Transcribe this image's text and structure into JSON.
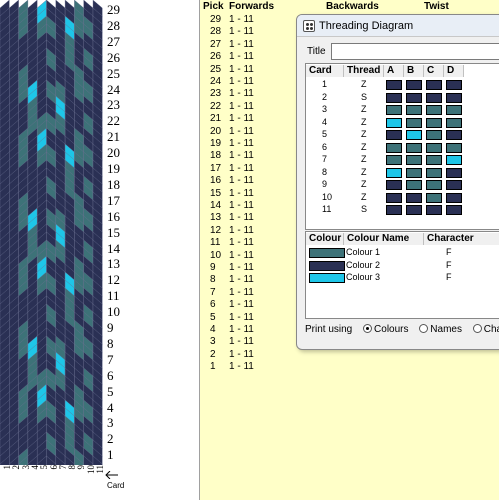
{
  "colors": {
    "colour1": "#3d7278",
    "colour2": "#2a3054",
    "colour3": "#1ec6e8",
    "chart_bg": "#ffffc8"
  },
  "weave": {
    "row_numbers": [
      "29",
      "28",
      "27",
      "26",
      "25",
      "24",
      "23",
      "22",
      "21",
      "20",
      "19",
      "18",
      "17",
      "16",
      "15",
      "14",
      "13",
      "12",
      "11",
      "10",
      "9",
      "8",
      "7",
      "6",
      "5",
      "4",
      "3",
      "2",
      "1"
    ],
    "card_numbers": [
      "1",
      "2",
      "3",
      "4",
      "5",
      "6",
      "7",
      "8",
      "9",
      "10",
      "11"
    ],
    "card_label": "Card"
  },
  "table": {
    "headers": {
      "pick": "Pick",
      "forwards": "Forwards",
      "backwards": "Backwards",
      "twist": "Twist"
    },
    "rows": [
      {
        "pick": "29",
        "forwards": "1 - 11"
      },
      {
        "pick": "28",
        "forwards": "1 - 11"
      },
      {
        "pick": "27",
        "forwards": "1 - 11"
      },
      {
        "pick": "26",
        "forwards": "1 - 11"
      },
      {
        "pick": "25",
        "forwards": "1 - 11"
      },
      {
        "pick": "24",
        "forwards": "1 - 11"
      },
      {
        "pick": "23",
        "forwards": "1 - 11"
      },
      {
        "pick": "22",
        "forwards": "1 - 11"
      },
      {
        "pick": "21",
        "forwards": "1 - 11"
      },
      {
        "pick": "20",
        "forwards": "1 - 11"
      },
      {
        "pick": "19",
        "forwards": "1 - 11"
      },
      {
        "pick": "18",
        "forwards": "1 - 11"
      },
      {
        "pick": "17",
        "forwards": "1 - 11"
      },
      {
        "pick": "16",
        "forwards": "1 - 11"
      },
      {
        "pick": "15",
        "forwards": "1 - 11"
      },
      {
        "pick": "14",
        "forwards": "1 - 11"
      },
      {
        "pick": "13",
        "forwards": "1 - 11"
      },
      {
        "pick": "12",
        "forwards": "1 - 11"
      },
      {
        "pick": "11",
        "forwards": "1 - 11"
      },
      {
        "pick": "10",
        "forwards": "1 - 11"
      },
      {
        "pick": "9",
        "forwards": "1 - 11"
      },
      {
        "pick": "8",
        "forwards": "1 - 11"
      },
      {
        "pick": "7",
        "forwards": "1 - 11"
      },
      {
        "pick": "6",
        "forwards": "1 - 11"
      },
      {
        "pick": "5",
        "forwards": "1 - 11"
      },
      {
        "pick": "4",
        "forwards": "1 - 11"
      },
      {
        "pick": "3",
        "forwards": "1 - 11"
      },
      {
        "pick": "2",
        "forwards": "1 - 11"
      },
      {
        "pick": "1",
        "forwards": "1 - 11"
      }
    ]
  },
  "dialog": {
    "title": "Threading Diagram",
    "title_label": "Title",
    "title_value": "",
    "threading": {
      "headers": [
        "Card",
        "Thread",
        "A",
        "B",
        "C",
        "D"
      ],
      "rows": [
        {
          "card": "1",
          "thread": "Z",
          "holes": [
            2,
            2,
            2,
            2
          ]
        },
        {
          "card": "2",
          "thread": "S",
          "holes": [
            2,
            2,
            2,
            2
          ]
        },
        {
          "card": "3",
          "thread": "Z",
          "holes": [
            1,
            1,
            1,
            1
          ]
        },
        {
          "card": "4",
          "thread": "Z",
          "holes": [
            3,
            1,
            1,
            1
          ]
        },
        {
          "card": "5",
          "thread": "Z",
          "holes": [
            2,
            3,
            1,
            2
          ]
        },
        {
          "card": "6",
          "thread": "Z",
          "holes": [
            1,
            1,
            1,
            1
          ]
        },
        {
          "card": "7",
          "thread": "Z",
          "holes": [
            1,
            1,
            1,
            3
          ]
        },
        {
          "card": "8",
          "thread": "Z",
          "holes": [
            3,
            1,
            1,
            2
          ]
        },
        {
          "card": "9",
          "thread": "Z",
          "holes": [
            2,
            1,
            1,
            2
          ]
        },
        {
          "card": "10",
          "thread": "Z",
          "holes": [
            2,
            2,
            1,
            2
          ]
        },
        {
          "card": "11",
          "thread": "S",
          "holes": [
            2,
            2,
            2,
            2
          ]
        }
      ]
    },
    "colours": {
      "headers": [
        "Colour",
        "Colour Name",
        "Character"
      ],
      "rows": [
        {
          "name": "Colour 1",
          "char": "F",
          "color": "#3d7278"
        },
        {
          "name": "Colour 2",
          "char": "F",
          "color": "#2a3054"
        },
        {
          "name": "Colour 3",
          "char": "F",
          "color": "#1ec6e8"
        }
      ]
    },
    "print_using": {
      "label": "Print using",
      "options": [
        "Colours",
        "Names",
        "Characters"
      ],
      "selected": "Colours",
      "visible_options": [
        "Colours",
        "Names",
        "Characte"
      ]
    }
  }
}
